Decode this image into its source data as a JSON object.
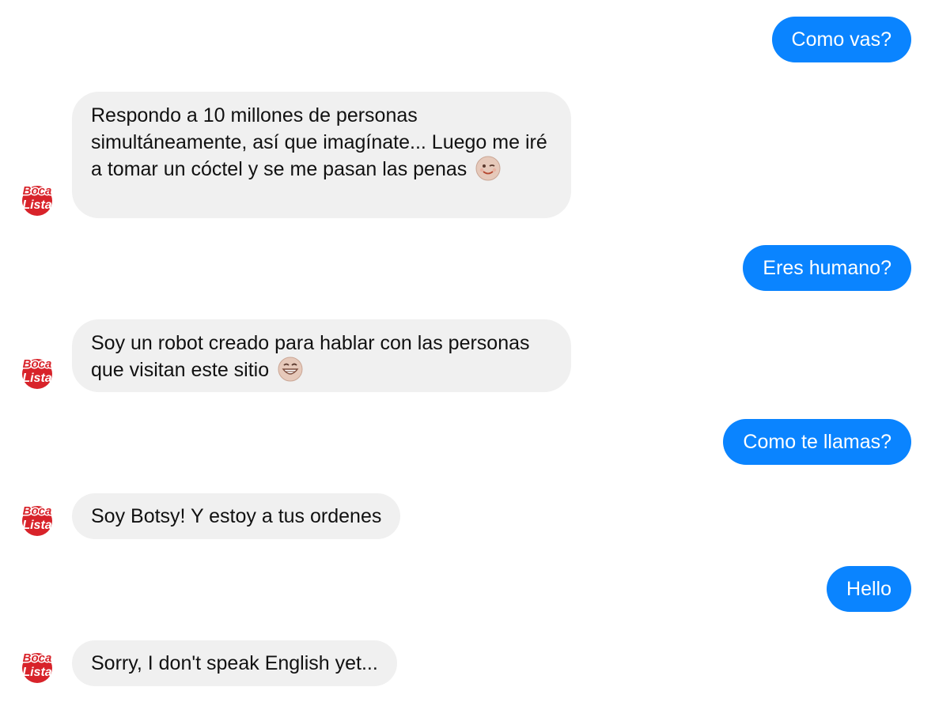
{
  "brand": {
    "name_top": "Boca",
    "name_bottom": "Lista",
    "red": "#d8232a"
  },
  "colors": {
    "outgoing_bubble": "#0a84ff",
    "incoming_bubble": "#f0f0f0"
  },
  "messages": [
    {
      "from": "user",
      "text": "Como vas?"
    },
    {
      "from": "bot",
      "text": "Respondo a 10 millones de personas simultáneamente, así que imagínate... Luego me iré a tomar un cóctel y se me pasan las penas",
      "emoji": "winking-face-icon"
    },
    {
      "from": "user",
      "text": "Eres humano?"
    },
    {
      "from": "bot",
      "text": "Soy un robot creado para hablar con las personas que visitan este sitio",
      "emoji": "grinning-face-icon"
    },
    {
      "from": "user",
      "text": "Como te llamas?"
    },
    {
      "from": "bot",
      "text": "Soy Botsy! Y estoy a tus ordenes"
    },
    {
      "from": "user",
      "text": "Hello"
    },
    {
      "from": "bot",
      "text": "Sorry, I don't speak English yet..."
    }
  ]
}
